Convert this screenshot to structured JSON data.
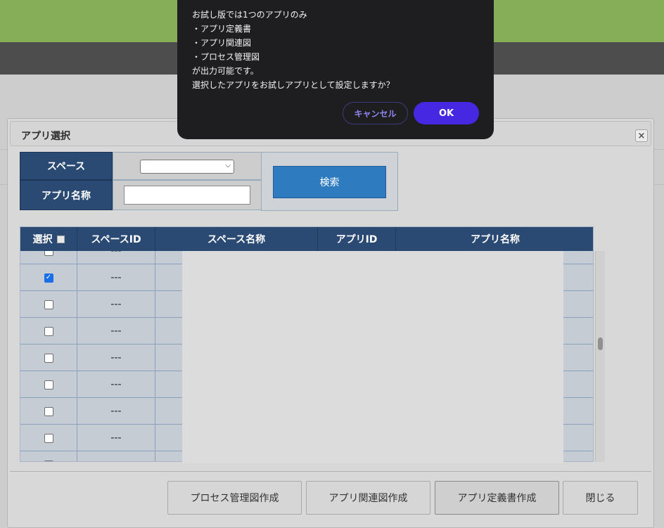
{
  "modal": {
    "title": "アプリ選択",
    "close_icon": "×"
  },
  "search": {
    "space_label": "スペース",
    "space_selected": "",
    "app_name_label": "アプリ名称",
    "app_name_value": "",
    "search_button": "検索"
  },
  "table": {
    "headers": [
      "選択",
      "スペースID",
      "スペース名称",
      "アプリID",
      "アプリ名称"
    ],
    "rows": [
      {
        "checked": false,
        "space_id": "---"
      },
      {
        "checked": true,
        "space_id": "---"
      },
      {
        "checked": false,
        "space_id": "---"
      },
      {
        "checked": false,
        "space_id": "---"
      },
      {
        "checked": false,
        "space_id": "---"
      },
      {
        "checked": false,
        "space_id": "---"
      },
      {
        "checked": false,
        "space_id": "---"
      },
      {
        "checked": false,
        "space_id": "---"
      },
      {
        "checked": false,
        "space_id": "---"
      }
    ]
  },
  "footer": {
    "buttons": [
      "プロセス管理図作成",
      "アプリ関連図作成",
      "アプリ定義書作成",
      "閉じる"
    ]
  },
  "dialog": {
    "message": "お試し版では1つのアプリのみ\n・アプリ定義書\n・アプリ関連図\n・プロセス管理図\nが出力可能です。\n選択したアプリをお試しアプリとして設定しますか？",
    "cancel": "キャンセル",
    "ok": "OK"
  },
  "colors": {
    "header_green": "#86ad58",
    "navy": "#2a4a73",
    "search_blue": "#2f7bc0",
    "ok_purple": "#4628e3",
    "checkbox_blue": "#1a6ee6"
  }
}
